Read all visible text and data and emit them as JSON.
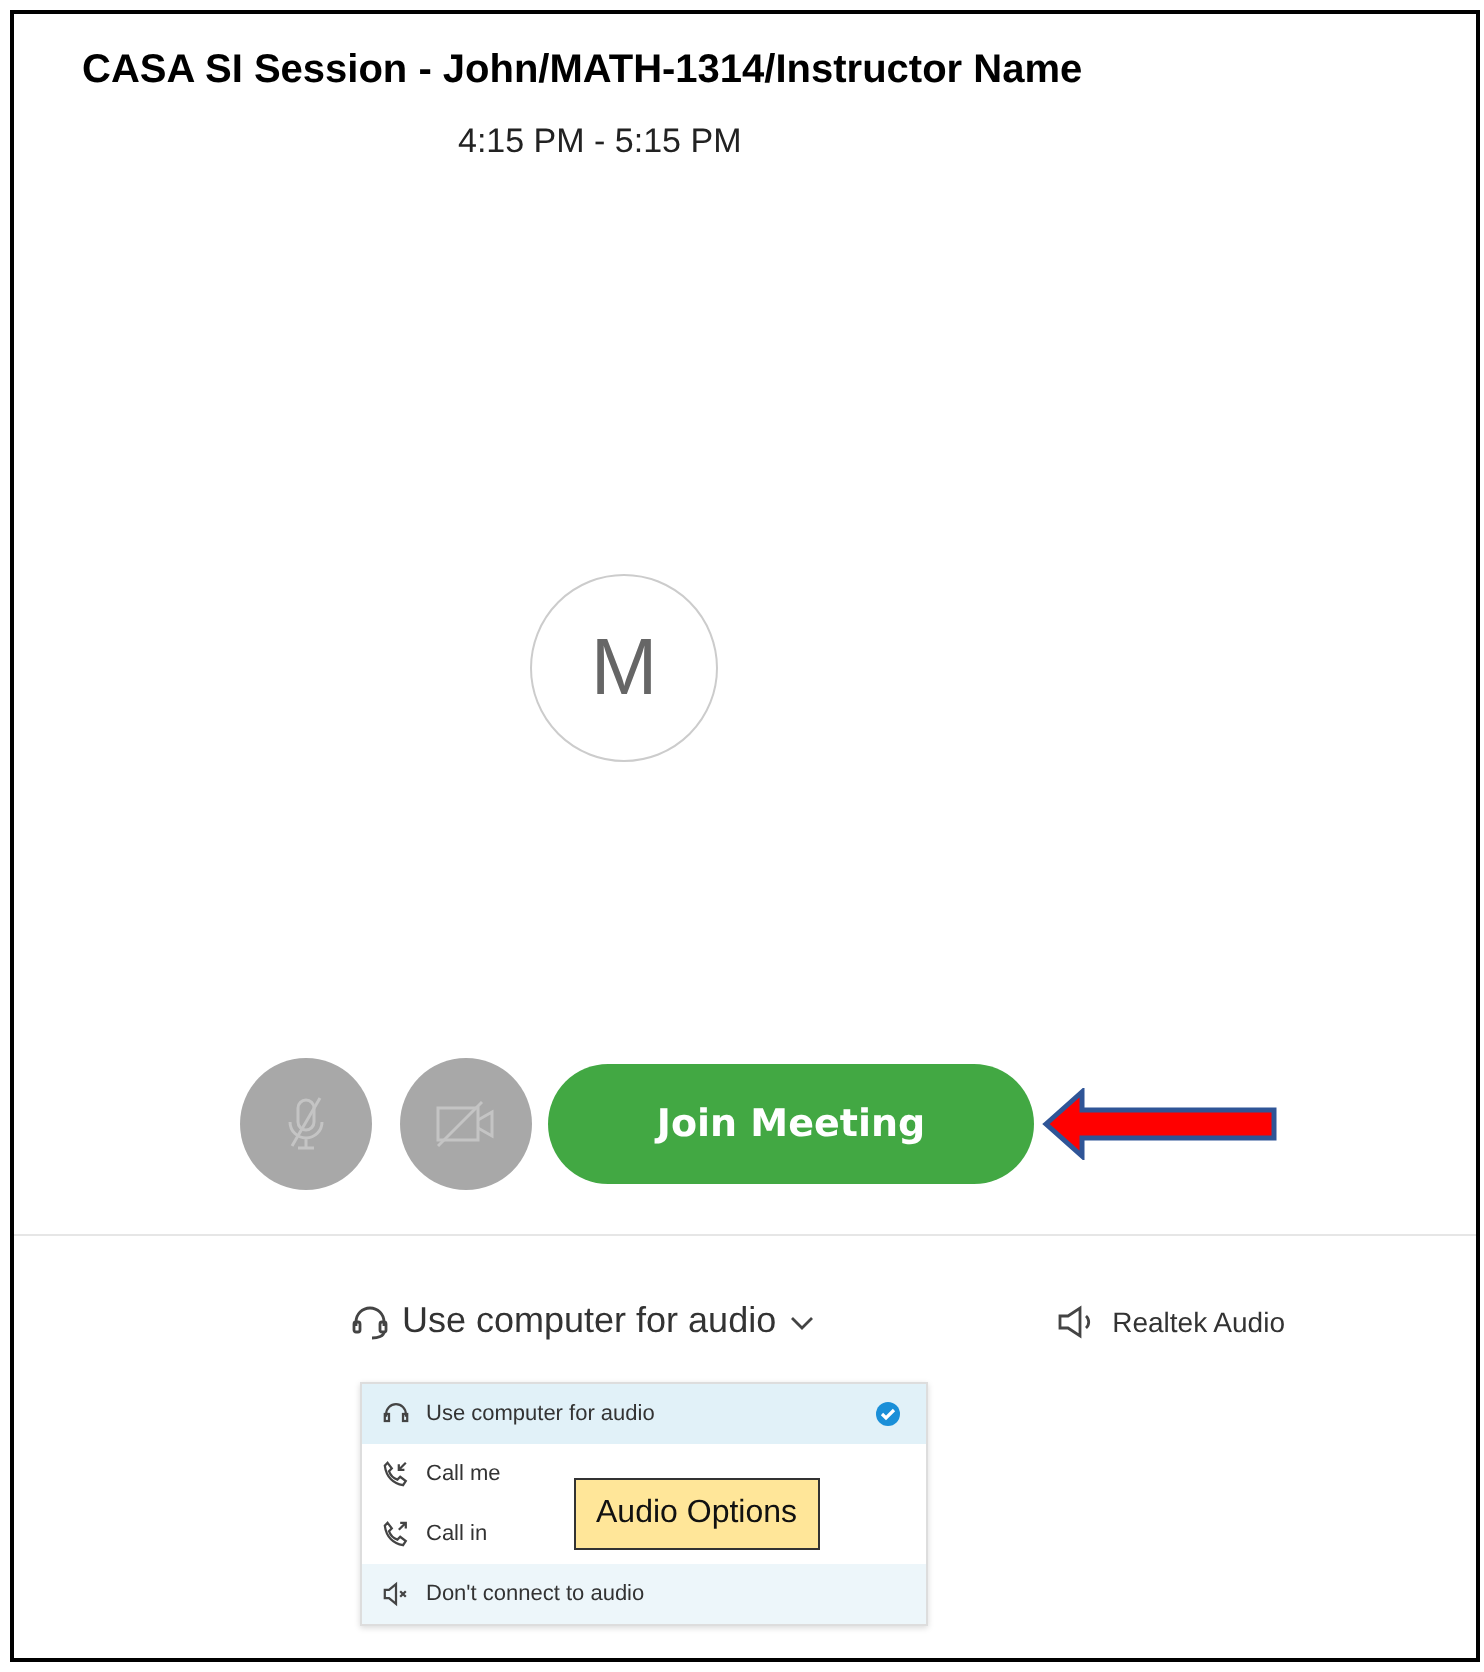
{
  "meeting": {
    "title": "CASA SI Session - John/MATH-1314/Instructor Name",
    "time": "4:15 PM - 5:15 PM",
    "avatar_initial": "M"
  },
  "controls": {
    "mic_muted": true,
    "camera_off": true,
    "join_label": "Join Meeting"
  },
  "audio": {
    "selector_label": "Use computer for audio",
    "speaker_label": "Realtek Audio",
    "options": [
      {
        "kind": "computer",
        "label": "Use computer for audio",
        "selected": true,
        "hovered": false
      },
      {
        "kind": "callme",
        "label": "Call me",
        "selected": false,
        "hovered": false
      },
      {
        "kind": "callin",
        "label": "Call in",
        "selected": false,
        "hovered": false
      },
      {
        "kind": "none",
        "label": "Don't connect to audio",
        "selected": false,
        "hovered": true
      }
    ]
  },
  "annotation": {
    "label": "Audio Options"
  }
}
